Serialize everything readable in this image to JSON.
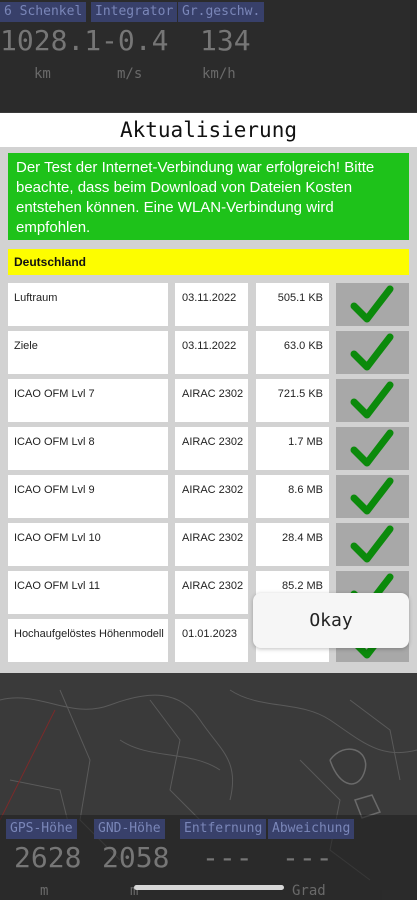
{
  "background": {
    "top_indicators": [
      {
        "label": "6 Schenkel",
        "value": "1028.1",
        "unit": "km"
      },
      {
        "label": "Integrator",
        "value": "-0.4",
        "unit": "m/s"
      },
      {
        "label": "Gr.geschw.",
        "value": "134",
        "unit": "km/h"
      }
    ],
    "bottom_indicators": [
      {
        "label": "GPS-Höhe",
        "value": "2628",
        "unit": "m"
      },
      {
        "label": "GND-Höhe",
        "value": "2058",
        "unit": "m"
      },
      {
        "label": "Entfernung",
        "value": "---",
        "unit": ""
      },
      {
        "label": "Abweichung",
        "value": "---",
        "unit": "Grad"
      }
    ]
  },
  "dialog": {
    "title": "Aktualisierung",
    "message": "Der Test der Internet-Verbindung war erfolgreich! Bitte beachte, dass beim Download von Dateien Kosten entstehen können. Eine WLAN-Verbindung wird empfohlen.",
    "region": "Deutschland",
    "rows": [
      {
        "name": "Luftraum",
        "date": "03.11.2022",
        "size": "505.1 KB",
        "status": "check-icon"
      },
      {
        "name": "Ziele",
        "date": "03.11.2022",
        "size": "63.0 KB",
        "status": "check-icon"
      },
      {
        "name": "ICAO OFM Lvl 7",
        "date": "AIRAC 2302",
        "size": "721.5 KB",
        "status": "check-icon"
      },
      {
        "name": "ICAO OFM Lvl 8",
        "date": "AIRAC 2302",
        "size": "1.7 MB",
        "status": "check-icon"
      },
      {
        "name": "ICAO OFM Lvl 9",
        "date": "AIRAC 2302",
        "size": "8.6 MB",
        "status": "check-icon"
      },
      {
        "name": "ICAO OFM Lvl 10",
        "date": "AIRAC 2302",
        "size": "28.4 MB",
        "status": "check-icon"
      },
      {
        "name": "ICAO OFM Lvl 11",
        "date": "AIRAC 2302",
        "size": "85.2 MB",
        "status": "check-icon"
      },
      {
        "name": "Hochaufgelöstes Höhenmodell",
        "date": "01.01.2023",
        "size": "",
        "status": "check-icon"
      }
    ],
    "okay_label": "Okay"
  },
  "colors": {
    "success": "#1ec21a",
    "highlight": "#fdfd00",
    "check": "#0b8a0b"
  }
}
